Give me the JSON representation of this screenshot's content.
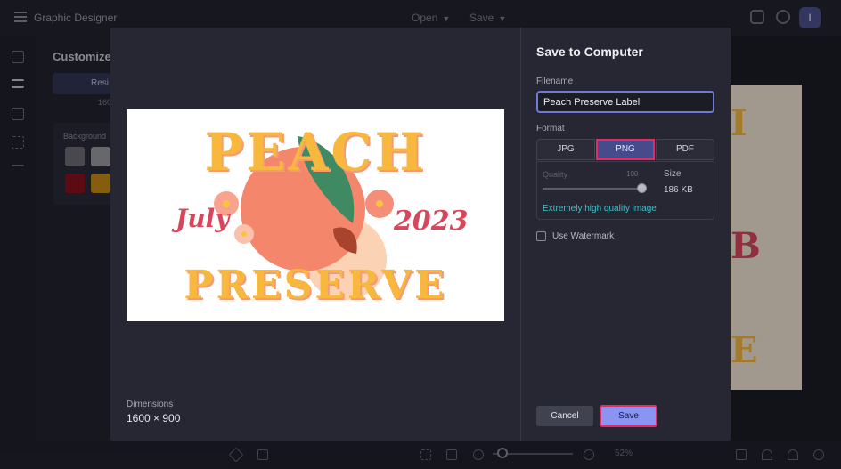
{
  "app": {
    "title": "Graphic Designer",
    "user_initial": "I"
  },
  "topbar": {
    "open_label": "Open",
    "save_label": "Save"
  },
  "panel": {
    "heading": "Customize",
    "tab_label": "Resi",
    "sub": "160",
    "background_label": "Background"
  },
  "swatches": [
    "#6b6b70",
    "#9a9aa0",
    "#8a0d14",
    "#c88a10"
  ],
  "canvas_letters": [
    "I",
    "B",
    "E"
  ],
  "zoom": {
    "level": "52%"
  },
  "dialog": {
    "title": "Save to Computer",
    "filename_label": "Filename",
    "filename_value": "Peach Preserve Label",
    "format_label": "Format",
    "formats": [
      "JPG",
      "PNG",
      "PDF"
    ],
    "selected_format": "PNG",
    "quality_label": "Quality",
    "quality_value": "100",
    "size_label": "Size",
    "size_value": "186 KB",
    "quality_note": "Extremely high quality image",
    "watermark_label": "Use Watermark",
    "watermark_checked": false,
    "cancel_label": "Cancel",
    "save_label": "Save",
    "dimensions_label": "Dimensions",
    "dimensions_value": "1600 × 900"
  },
  "preview": {
    "word_top": "PEACH",
    "word_bottom": "PRESERVE",
    "left_text": "July",
    "right_text": "2023",
    "colors": {
      "gold": "#f8b73d",
      "coral": "#f4876b",
      "leaf": "#3f8a62",
      "text_red": "#d9455a"
    }
  }
}
